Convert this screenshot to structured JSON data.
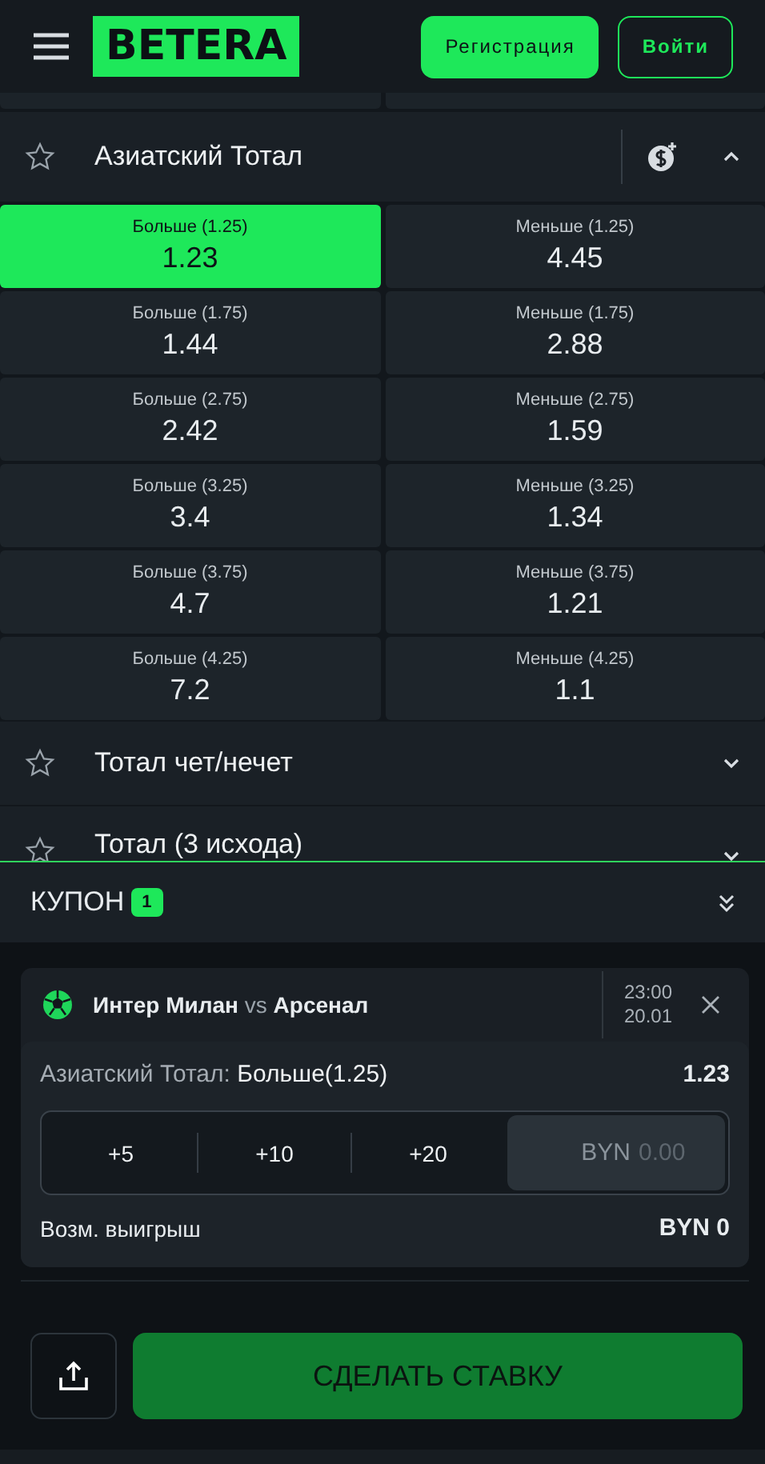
{
  "header": {
    "logo": "BETERA",
    "register": "Регистрация",
    "login": "Войти"
  },
  "open_market": {
    "title": "Азиатский Тотал",
    "expanded": true,
    "outcomes": [
      {
        "label": "Больше (1.25)",
        "odds": "1.23",
        "selected": true
      },
      {
        "label": "Меньше (1.25)",
        "odds": "4.45",
        "selected": false
      },
      {
        "label": "Больше (1.75)",
        "odds": "1.44",
        "selected": false
      },
      {
        "label": "Меньше (1.75)",
        "odds": "2.88",
        "selected": false
      },
      {
        "label": "Больше (2.75)",
        "odds": "2.42",
        "selected": false
      },
      {
        "label": "Меньше (2.75)",
        "odds": "1.59",
        "selected": false
      },
      {
        "label": "Больше (3.25)",
        "odds": "3.4",
        "selected": false
      },
      {
        "label": "Меньше (3.25)",
        "odds": "1.34",
        "selected": false
      },
      {
        "label": "Больше (3.75)",
        "odds": "4.7",
        "selected": false
      },
      {
        "label": "Меньше (3.75)",
        "odds": "1.21",
        "selected": false
      },
      {
        "label": "Больше (4.25)",
        "odds": "7.2",
        "selected": false
      },
      {
        "label": "Меньше (4.25)",
        "odds": "1.1",
        "selected": false
      }
    ]
  },
  "markets": [
    {
      "title": "Тотал чет/нечет",
      "expanded": false
    },
    {
      "title": "Тотал (3 исхода)",
      "expanded": false
    }
  ],
  "coupon": {
    "title": "КУПОН",
    "count": "1",
    "bet": {
      "home": "Интер Милан",
      "vs": "vs",
      "away": "Арсенал",
      "time": "23:00",
      "date": "20.01",
      "market": "Азиатский Тотал:",
      "pick": "Больше(1.25)",
      "odds": "1.23",
      "quick_amounts": [
        "+5",
        "+10",
        "+20"
      ],
      "stake": {
        "currency": "BYN",
        "placeholder": "0.00"
      },
      "payout_label": "Возм. выигрыш",
      "payout": "BYN 0"
    },
    "submit": "СДЕЛАТЬ СТАВКУ"
  }
}
